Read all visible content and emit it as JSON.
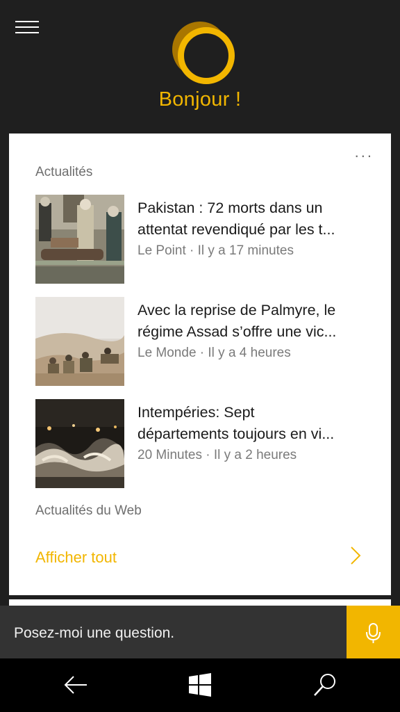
{
  "header": {
    "menu_icon": "hamburger-menu-icon",
    "avatar_icon": "cortana-ring-icon",
    "greeting": "Bonjour !"
  },
  "news_card": {
    "more_label": "...",
    "section_label": "Actualités",
    "items": [
      {
        "title_line1": "Pakistan : 72 morts dans un",
        "title_line2": "attentat revendiqué par les t...",
        "meta": "Le Point · Il y a 17 minutes"
      },
      {
        "title_line1": "Avec la reprise de Palmyre, le",
        "title_line2": "régime Assad s’offre une vic...",
        "meta": "Le Monde · Il y a 4 heures"
      },
      {
        "title_line1": "Intempéries: Sept",
        "title_line2": "départements toujours en vi...",
        "meta": "20 Minutes · Il y a 2 heures"
      }
    ],
    "web_label": "Actualités du Web",
    "see_all_label": "Afficher tout"
  },
  "ask_bar": {
    "placeholder": "Posez-moi une question.",
    "mic_icon": "microphone-icon"
  },
  "navbar": {
    "back_icon": "back-arrow-icon",
    "home_icon": "windows-logo-icon",
    "search_icon": "search-icon"
  },
  "colors": {
    "accent": "#f2b600",
    "background": "#1f1f1f",
    "card": "#ffffff",
    "ask_bar": "#333333",
    "navbar": "#000000"
  }
}
